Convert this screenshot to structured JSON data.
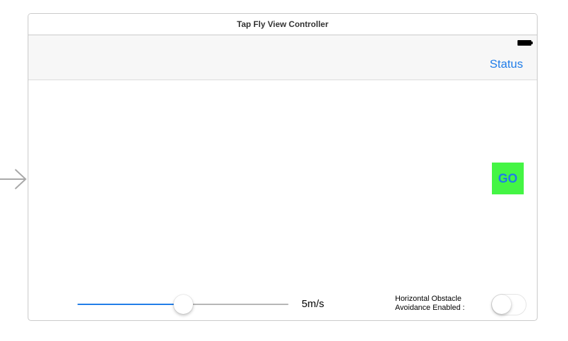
{
  "scene": {
    "title": "Tap Fly View Controller"
  },
  "entry_arrow_icon": "arrow-right-icon",
  "nav_bar": {
    "battery_icon": "battery-icon",
    "status_label": "Status",
    "accent_color": "#1f7ce8"
  },
  "go_button": {
    "label": "GO",
    "background_color": "#44f544"
  },
  "speed": {
    "value_label": "5m/s",
    "slider_fraction": 0.5
  },
  "obstacle_avoidance": {
    "label_line1": "Horizontal Obstacle",
    "label_line2": "Avoidance Enabled :",
    "enabled": false
  }
}
